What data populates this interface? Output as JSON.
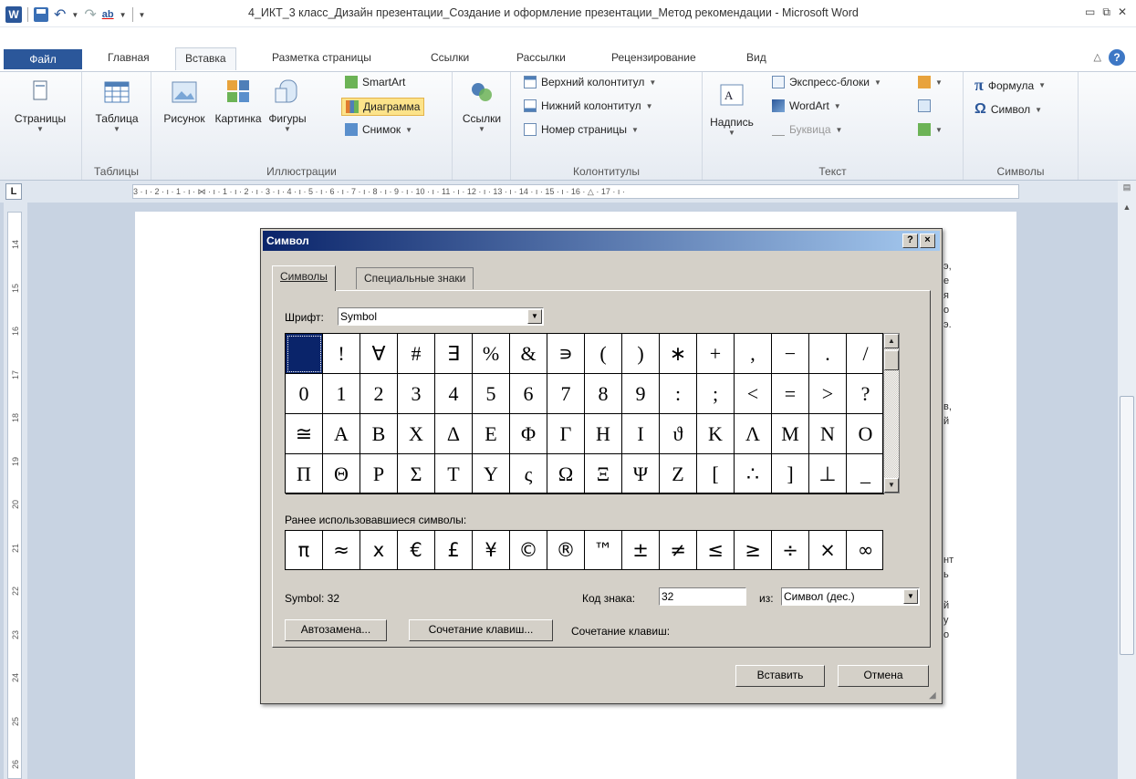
{
  "titlebar": {
    "title": "4_ИКТ_3 класс_Дизайн презентации_Создание и оформление презентации_Метод рекомендации  -  Microsoft Word"
  },
  "tabs": {
    "file": "Файл",
    "items": [
      "Главная",
      "Вставка",
      "Разметка страницы",
      "Ссылки",
      "Рассылки",
      "Рецензирование",
      "Вид"
    ],
    "active": "Вставка"
  },
  "ribbon": {
    "pages": "Страницы",
    "table": "Таблица",
    "tables_group": "Таблицы",
    "picture": "Рисунок",
    "clipart": "Картинка",
    "shapes": "Фигуры",
    "smartart": "SmartArt",
    "chart": "Диаграмма",
    "screenshot": "Снимок",
    "illustrations_group": "Иллюстрации",
    "links": "Ссылки",
    "header": "Верхний колонтитул",
    "footer": "Нижний колонтитул",
    "page_number": "Номер страницы",
    "headers_group": "Колонтитулы",
    "textbox": "Надпись",
    "quickparts": "Экспресс-блоки",
    "wordart": "WordArt",
    "dropcap": "Буквица",
    "text_group": "Текст",
    "equation": "Формула",
    "symbol": "Символ",
    "symbols_group": "Символы"
  },
  "ruler": {
    "h_text": "3 · ı · 2 · ı · 1 · ı · ⋈ · ı · 1 · ı · 2 · ı · 3 · ı · 4 · ı · 5 · ı · 6 · ı · 7 · ı · 8 · ı · 9 · ı · 10 · ı · 11 · ı · 12 · ı · 13 · ı · 14 · ı · 15 · ı · 16 · △ · 17 · ı ·",
    "v_numbers": [
      "14",
      "15",
      "16",
      "17",
      "18",
      "19",
      "20",
      "21",
      "22",
      "23",
      "24",
      "25",
      "26"
    ]
  },
  "document_fragments": [
    "э,",
    "е",
    "я",
    "о",
    "э.",
    "в,",
    "й",
    "нт",
    "ь",
    "й",
    "у",
    "о"
  ],
  "dialog": {
    "title": "Символ",
    "help": "?",
    "close": "×",
    "tab_symbols": "Символы",
    "tab_special": "Специальные знаки",
    "font_label": "Шрифт:",
    "font_value": "Symbol",
    "symbols": [
      " ",
      "!",
      "∀",
      "#",
      "∃",
      "%",
      "&",
      "∍",
      "(",
      ")",
      "∗",
      "+",
      ",",
      "−",
      ".",
      "/",
      "0",
      "1",
      "2",
      "3",
      "4",
      "5",
      "6",
      "7",
      "8",
      "9",
      ":",
      ";",
      "<",
      "=",
      ">",
      "?",
      "≅",
      "Α",
      "Β",
      "Χ",
      "Δ",
      "Ε",
      "Φ",
      "Γ",
      "Η",
      "Ι",
      "ϑ",
      "Κ",
      "Λ",
      "Μ",
      "Ν",
      "Ο",
      "Π",
      "Θ",
      "Ρ",
      "Σ",
      "Τ",
      "Υ",
      "ς",
      "Ω",
      "Ξ",
      "Ψ",
      "Ζ",
      "[",
      "∴",
      "]",
      "⊥",
      "_"
    ],
    "recent_label": "Ранее использовавшиеся символы:",
    "recent": [
      "π",
      "≈",
      "x",
      "€",
      "£",
      "¥",
      "©",
      "®",
      "™",
      "±",
      "≠",
      "≤",
      "≥",
      "÷",
      "×",
      "∞"
    ],
    "symbol_info": "Symbol: 32",
    "code_label": "Код знака:",
    "code_value": "32",
    "from_label": "из:",
    "from_value": "Символ (дес.)",
    "autocorrect": "Автозамена...",
    "shortcut_btn": "Сочетание клавиш...",
    "shortcut_label": "Сочетание клавиш:",
    "insert": "Вставить",
    "cancel": "Отмена"
  }
}
